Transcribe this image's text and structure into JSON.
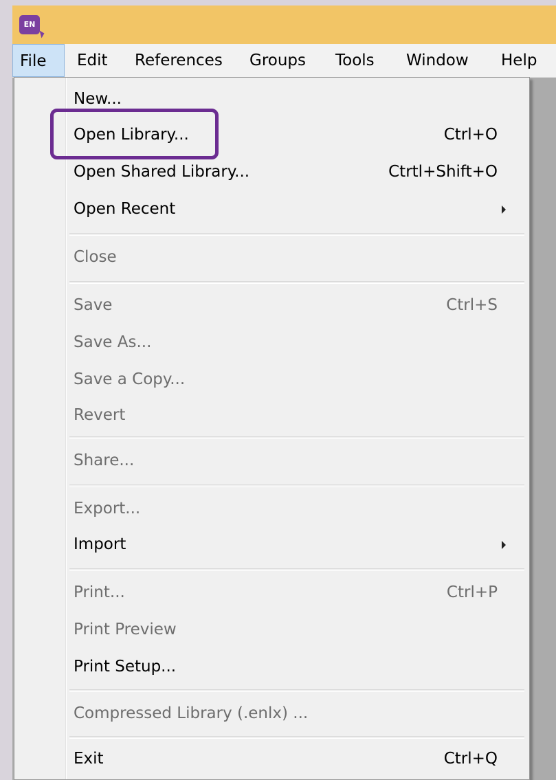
{
  "app": {
    "icon_label": "EN"
  },
  "menubar": {
    "items": [
      {
        "label": "File",
        "active": true
      },
      {
        "label": "Edit"
      },
      {
        "label": "References"
      },
      {
        "label": "Groups"
      },
      {
        "label": "Tools"
      },
      {
        "label": "Window"
      },
      {
        "label": "Help"
      }
    ]
  },
  "file_menu": {
    "items": [
      {
        "label": "New...",
        "shortcut": "",
        "enabled": true
      },
      {
        "label": "Open Library...",
        "shortcut": "Ctrl+O",
        "enabled": true,
        "highlighted": true
      },
      {
        "label": "Open Shared Library...",
        "shortcut": "Ctrtl+Shift+O",
        "enabled": true
      },
      {
        "label": "Open Recent",
        "shortcut": "",
        "enabled": true,
        "submenu": true
      },
      {
        "label": "Close",
        "shortcut": "",
        "enabled": false
      },
      {
        "label": "Save",
        "shortcut": "Ctrl+S",
        "enabled": false
      },
      {
        "label": "Save As...",
        "shortcut": "",
        "enabled": false
      },
      {
        "label": "Save a Copy...",
        "shortcut": "",
        "enabled": false
      },
      {
        "label": "Revert",
        "shortcut": "",
        "enabled": false
      },
      {
        "label": "Share...",
        "shortcut": "",
        "enabled": false
      },
      {
        "label": "Export...",
        "shortcut": "",
        "enabled": false
      },
      {
        "label": "Import",
        "shortcut": "",
        "enabled": true,
        "submenu": true
      },
      {
        "label": "Print...",
        "shortcut": "Ctrl+P",
        "enabled": false
      },
      {
        "label": "Print Preview",
        "shortcut": "",
        "enabled": false
      },
      {
        "label": "Print Setup...",
        "shortcut": "",
        "enabled": true
      },
      {
        "label": "Compressed Library (.enlx) ...",
        "shortcut": "",
        "enabled": false
      },
      {
        "label": "Exit",
        "shortcut": "Ctrl+Q",
        "enabled": true
      }
    ]
  },
  "colors": {
    "titlebar": "#f2c566",
    "highlight_box": "#6b2c91",
    "app_icon": "#7b3fa0",
    "active_menu": "#cde3f7"
  }
}
